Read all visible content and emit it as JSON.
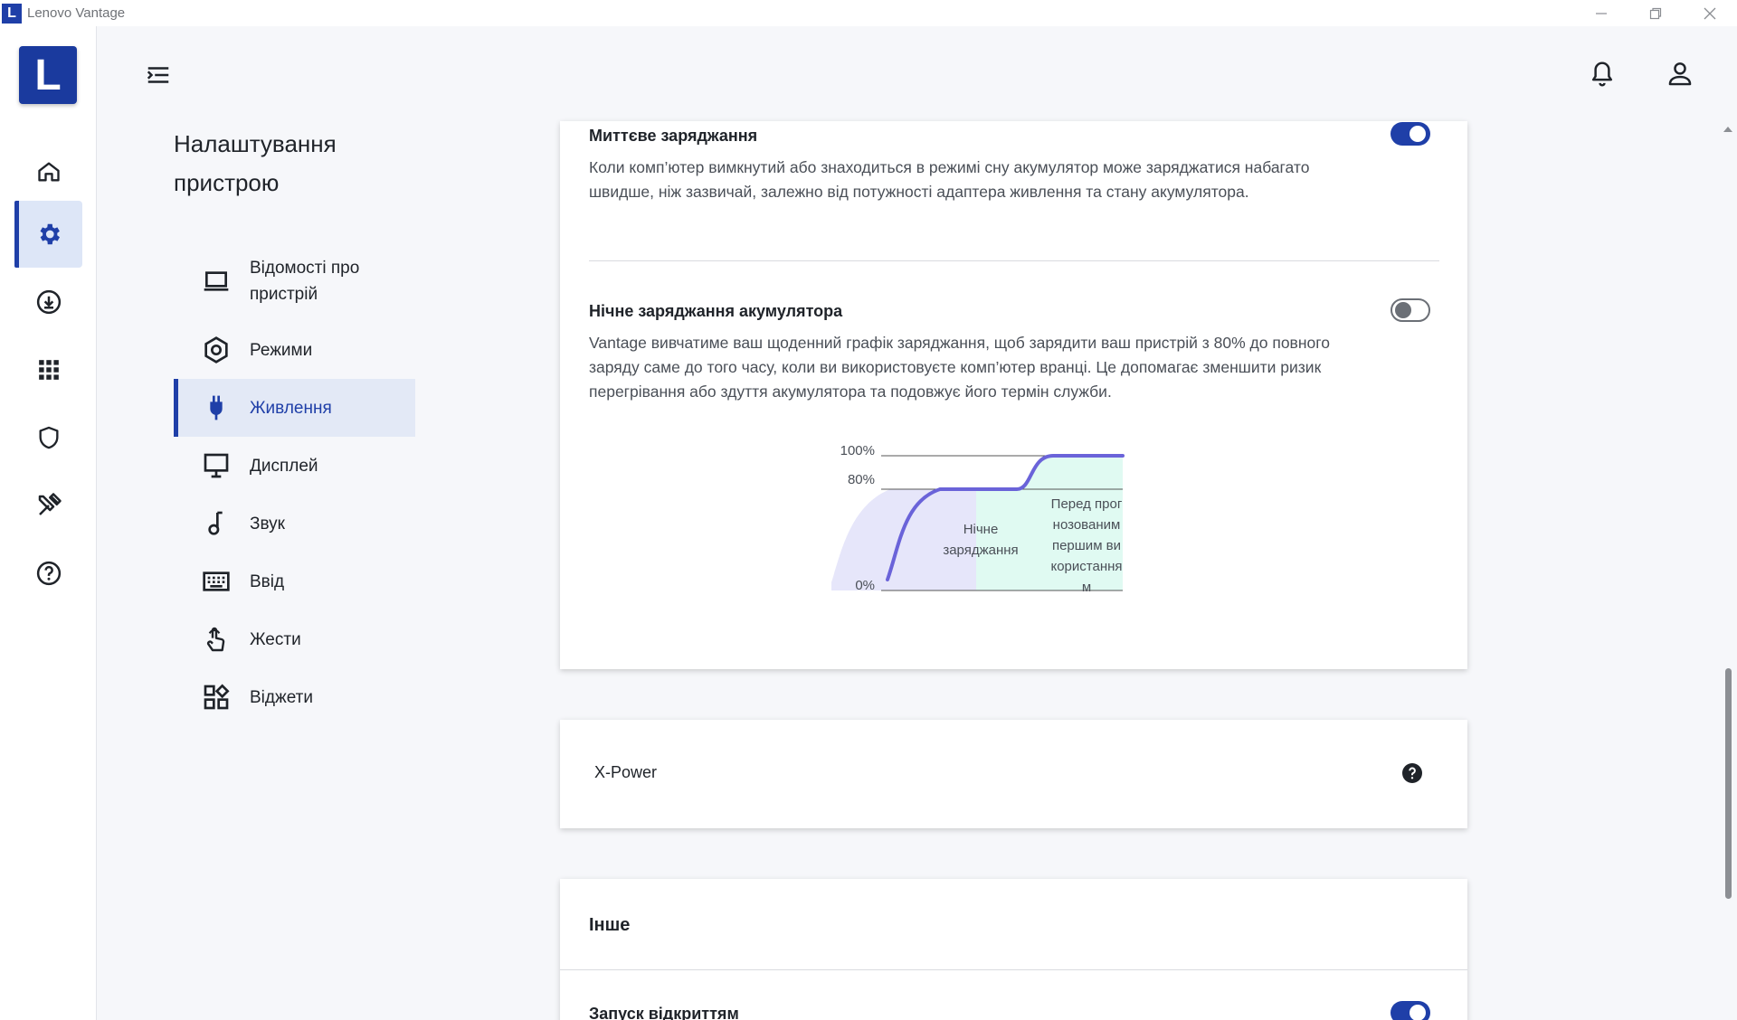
{
  "window": {
    "app_logo_letter": "L",
    "title": "Lenovo Vantage"
  },
  "rail": {
    "logo_letter": "L",
    "items": [
      {
        "name": "home",
        "icon": "home-icon"
      },
      {
        "name": "device-settings",
        "icon": "gear-icon",
        "active": true
      },
      {
        "name": "updates",
        "icon": "download-icon"
      },
      {
        "name": "apps",
        "icon": "grid-icon"
      },
      {
        "name": "security",
        "icon": "shield-icon"
      },
      {
        "name": "tools",
        "icon": "tools-icon"
      },
      {
        "name": "help",
        "icon": "question-icon"
      }
    ]
  },
  "nav": {
    "title": "Налаштування пристрою",
    "items": [
      {
        "label": "Відомості про пристрій",
        "icon": "laptop-icon"
      },
      {
        "label": "Режими",
        "icon": "hexagon-icon"
      },
      {
        "label": "Живлення",
        "icon": "plug-icon",
        "active": true
      },
      {
        "label": "Дисплей",
        "icon": "monitor-icon"
      },
      {
        "label": "Звук",
        "icon": "music-note-icon"
      },
      {
        "label": "Ввід",
        "icon": "keyboard-icon"
      },
      {
        "label": "Жести",
        "icon": "touch-icon"
      },
      {
        "label": "Віджети",
        "icon": "widgets-icon"
      }
    ]
  },
  "power_card": {
    "instant_charge": {
      "title": "Миттєве заряджання",
      "description": "Коли комп’ютер вимкнутий або знаходиться в режимі сну акумулятор може заряджатися набагато швидше, ніж зазвичай, залежно від потужності адаптера живлення та стану акумулятора.",
      "enabled": true
    },
    "overnight_charge": {
      "title": "Нічне заряджання акумулятора",
      "description": "Vantage вивчатиме ваш щоденний графік заряджання, щоб зарядити ваш пристрій з 80% до повного заряду саме до того часу, коли ви використовуєте комп’ютер вранці. Це допомагає зменшити ризик перегрівання або здуття акумулятора та подовжує його термін служби.",
      "enabled": false
    },
    "diagram": {
      "label_100": "100%",
      "label_80": "80%",
      "label_0": "0%",
      "region_night": "Нічне заряджання",
      "region_before": "Перед прогнозованим першим використанням",
      "colors": {
        "curve": "#6a63d9",
        "night_fill": "#e6e6fa",
        "before_fill": "#e0faf2"
      }
    }
  },
  "xpower_card": {
    "title": "X-Power"
  },
  "other_card": {
    "title": "Інше",
    "autostart": {
      "title": "Запуск відкриттям",
      "enabled": true
    }
  },
  "colors": {
    "accent": "#1f3fa8"
  }
}
